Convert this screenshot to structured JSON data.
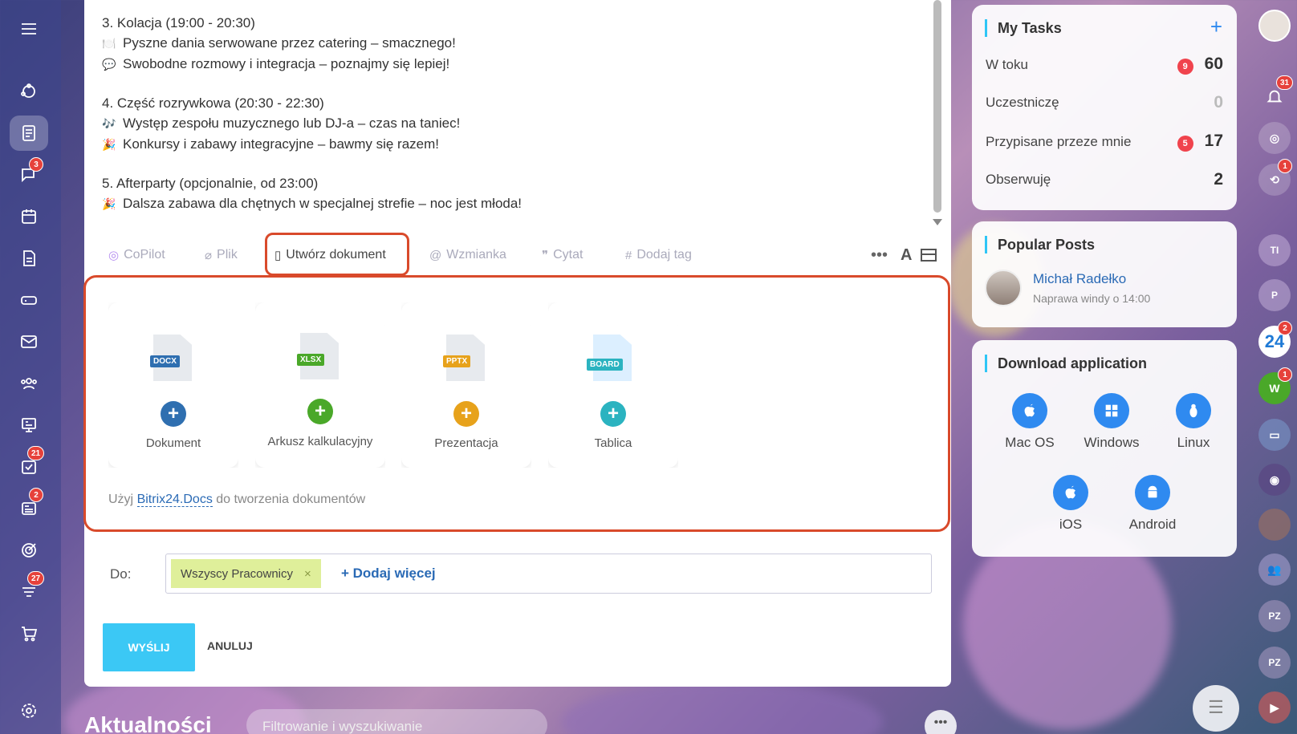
{
  "post": {
    "lines": [
      {
        "emoji": "",
        "text": "3. Kolacja (19:00 - 20:30)"
      },
      {
        "emoji": "🍽️",
        "text": "Pyszne dania serwowane przez catering – smacznego!"
      },
      {
        "emoji": "💬",
        "text": "Swobodne rozmowy i integracja – poznajmy się lepiej!"
      },
      {
        "emoji": "",
        "text": ""
      },
      {
        "emoji": "",
        "text": "4. Część rozrywkowa (20:30 - 22:30)"
      },
      {
        "emoji": "🎶",
        "text": "Występ zespołu muzycznego lub DJ-a – czas na taniec!"
      },
      {
        "emoji": "🎉",
        "text": "Konkursy i zabawy integracyjne – bawmy się razem!"
      },
      {
        "emoji": "",
        "text": ""
      },
      {
        "emoji": "",
        "text": "5. Afterparty (opcjonalnie, od 23:00)"
      },
      {
        "emoji": "🎉",
        "text": "Dalsza zabawa dla chętnych w specjalnej strefie – noc jest młoda!"
      }
    ]
  },
  "toolbar": {
    "copilot": "CoPilot",
    "file": "Plik",
    "create_doc": "Utwórz dokument",
    "mention": "Wzmianka",
    "quote": "Cytat",
    "tag": "Dodaj tag"
  },
  "doc_tiles": [
    {
      "tag": "DOCX",
      "label": "Dokument",
      "color": "#2f6fb0",
      "plus_color": "#2f6fb0"
    },
    {
      "tag": "XLSX",
      "label": "Arkusz kalkulacyjny",
      "color": "#4aa829",
      "plus_color": "#4aa829"
    },
    {
      "tag": "PPTX",
      "label": "Prezentacja",
      "color": "#e7a21b",
      "plus_color": "#e7a21b"
    },
    {
      "tag": "BOARD",
      "label": "Tablica",
      "color": "#2bb3c0",
      "plus_color": "#2bb3c0"
    }
  ],
  "docs_note": {
    "prefix": "Użyj ",
    "link": "Bitrix24.Docs",
    "suffix": " do tworzenia dokumentów"
  },
  "recipients": {
    "label": "Do:",
    "chip": "Wszyscy Pracownicy",
    "add_more": "+ Dodaj więcej"
  },
  "actions": {
    "send": "WYŚLIJ",
    "cancel": "ANULUJ"
  },
  "feed": {
    "title": "Aktualności",
    "filter_placeholder": "Filtrowanie i wyszukiwanie"
  },
  "my_tasks": {
    "title": "My Tasks",
    "rows": [
      {
        "label": "W toku",
        "badge": "9",
        "count": "60"
      },
      {
        "label": "Uczestniczę",
        "badge": "",
        "count": "0"
      },
      {
        "label": "Przypisane przeze mnie",
        "badge": "5",
        "count": "17"
      },
      {
        "label": "Obserwuję",
        "badge": "",
        "count": "2"
      }
    ]
  },
  "popular_posts": {
    "title": "Popular Posts",
    "author": "Michał Radełko",
    "subtitle": "Naprawa windy o 14:00"
  },
  "download": {
    "title": "Download application",
    "apps": [
      "Mac OS",
      "Windows",
      "Linux",
      "iOS",
      "Android"
    ]
  },
  "left_badges": {
    "chat": "3",
    "tasks": "21",
    "news": "2",
    "funnel": "27"
  },
  "right_badges": {
    "bell": "31",
    "sync": "1",
    "b24": "2",
    "w": "1"
  },
  "right_rail": {
    "ti": "TI",
    "p": "P",
    "b24": "24",
    "w": "W",
    "pz1": "PZ",
    "pz2": "PZ"
  }
}
